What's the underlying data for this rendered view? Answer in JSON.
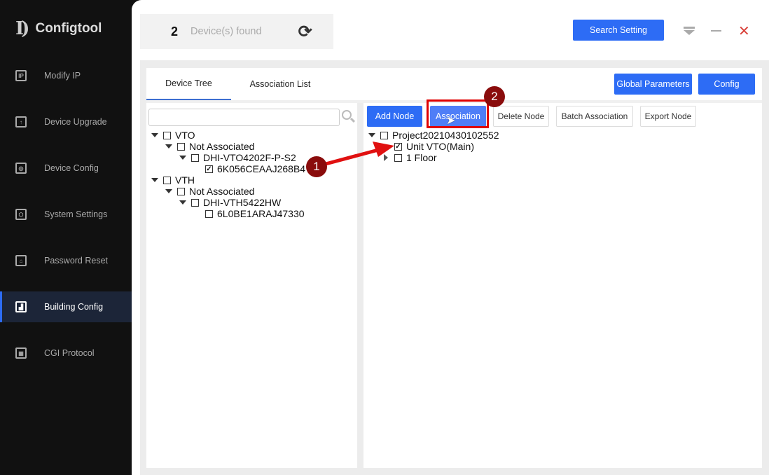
{
  "app": {
    "name": "Configtool",
    "logo_text": "ID"
  },
  "sidebar": {
    "items": [
      {
        "label": "Modify IP",
        "icon": "ip-icon",
        "active": false
      },
      {
        "label": "Device Upgrade",
        "icon": "upload-icon",
        "active": false
      },
      {
        "label": "Device Config",
        "icon": "config-icon",
        "active": false
      },
      {
        "label": "System Settings",
        "icon": "gear-icon",
        "active": false
      },
      {
        "label": "Password Reset",
        "icon": "lock-icon",
        "active": false
      },
      {
        "label": "Building Config",
        "icon": "building-icon",
        "active": true
      },
      {
        "label": "CGI Protocol",
        "icon": "grid-icon",
        "active": false
      }
    ]
  },
  "header": {
    "count": "2",
    "count_label": "Device(s) found",
    "search_setting": "Search Setting"
  },
  "tabs": [
    {
      "label": "Device Tree",
      "active": true
    },
    {
      "label": "Association List",
      "active": false
    }
  ],
  "top_buttons": {
    "global": "Global Parameters",
    "config": "Config"
  },
  "search": {
    "placeholder": "",
    "value": ""
  },
  "toolbar": [
    "Add Node",
    "Association",
    "Delete Node",
    "Batch Association",
    "Export Node"
  ],
  "device_tree": [
    {
      "label": "VTO",
      "level": 0,
      "expand": "down",
      "checked": false
    },
    {
      "label": "Not Associated",
      "level": 1,
      "expand": "down",
      "checked": false
    },
    {
      "label": "DHI-VTO4202F-P-S2",
      "level": 2,
      "expand": "down",
      "checked": false
    },
    {
      "label": "6K056CEAAJ268B4",
      "level": 3,
      "expand": "none",
      "checked": true
    },
    {
      "label": "VTH",
      "level": 0,
      "expand": "down",
      "checked": false
    },
    {
      "label": "Not Associated",
      "level": 1,
      "expand": "down",
      "checked": false
    },
    {
      "label": "DHI-VTH5422HW",
      "level": 2,
      "expand": "down",
      "checked": false
    },
    {
      "label": "6L0BE1ARAJ47330",
      "level": 3,
      "expand": "none",
      "checked": false
    }
  ],
  "project_tree": [
    {
      "label": "Project20210430102552",
      "level": 0,
      "expand": "down",
      "checked": false
    },
    {
      "label": "Unit VTO(Main)",
      "level": 1,
      "expand": "none",
      "checked": true
    },
    {
      "label": "1 Floor",
      "level": 1,
      "expand": "right",
      "checked": false
    }
  ],
  "annotations": [
    "1",
    "2"
  ],
  "colors": {
    "accent": "#2d6cf5",
    "highlight": "#e00000",
    "badge": "#8a0c0c"
  }
}
